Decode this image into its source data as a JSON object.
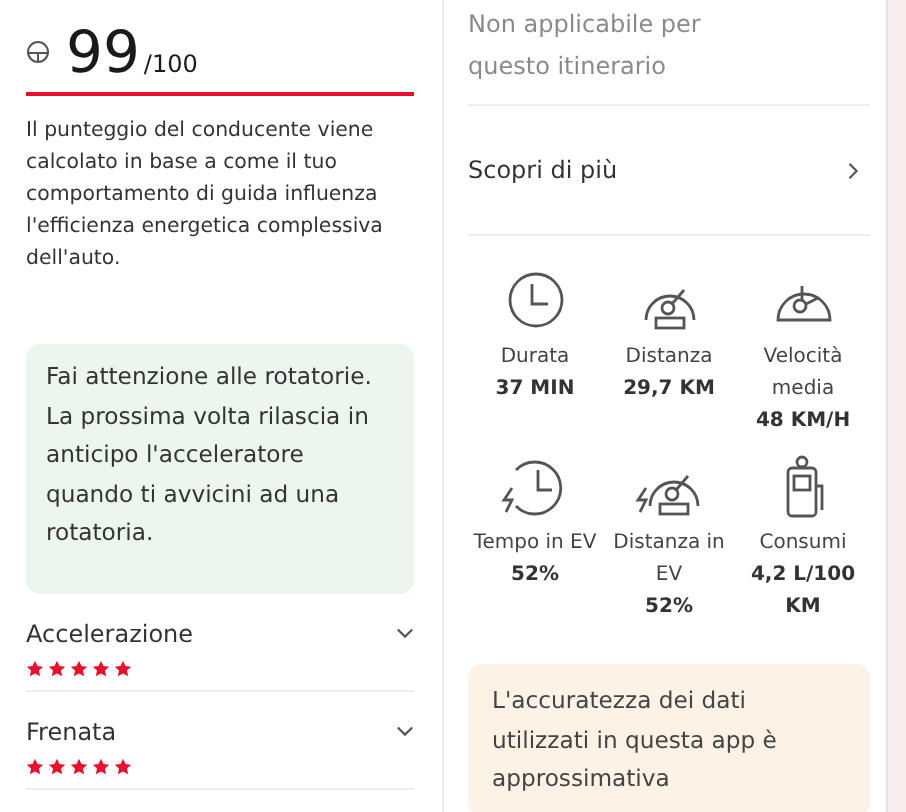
{
  "score": {
    "value": "99",
    "max": "/100",
    "description": "Il punteggio del conducente viene calcolato in base a come il tuo comportamento di guida influenza l'efficienza energetica complessiva dell'auto."
  },
  "tip": "Fai attenzione alle rotatorie. La prossima volta rilascia in anticipo l'acceleratore quando ti avvicini ad una rotatoria.",
  "ratings": [
    {
      "label": "Accelerazione",
      "stars": 5,
      "expanded": false
    },
    {
      "label": "Frenata",
      "stars": 5,
      "expanded": false
    }
  ],
  "not_applicable": "Non applicabile per questo itinerario",
  "learn_more": "Scopri di più",
  "stats": [
    {
      "kind": "clock",
      "label": "Durata",
      "value": "37 MIN"
    },
    {
      "kind": "odometer",
      "label": "Distanza",
      "value": "29,7 KM"
    },
    {
      "kind": "speedometer",
      "label": "Velocità media",
      "value": "48 KM/H"
    },
    {
      "kind": "ev-clock",
      "label": "Tempo in EV",
      "value": "52%"
    },
    {
      "kind": "ev-odometer",
      "label": "Distanza in EV",
      "value": "52%"
    },
    {
      "kind": "fuel",
      "label": "Consumi",
      "value": "4,2 L/100 KM"
    }
  ],
  "notice": "L'accuratezza dei dati utilizzati in questa app è approssimativa"
}
